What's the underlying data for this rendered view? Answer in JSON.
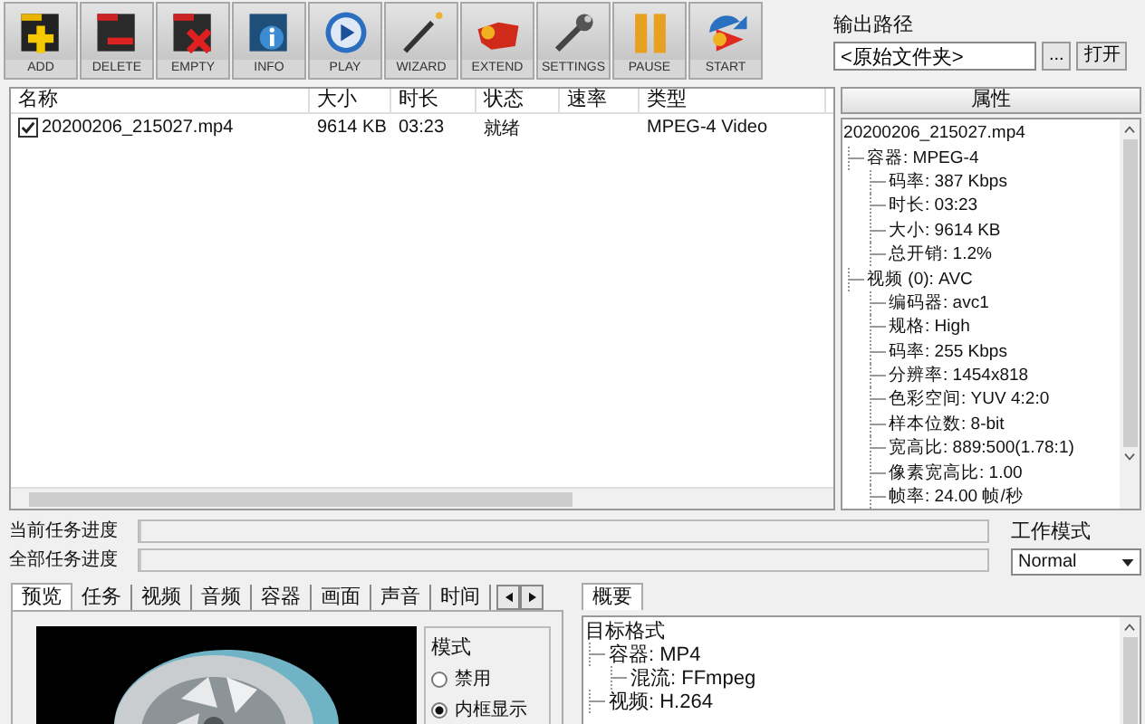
{
  "toolbar": [
    {
      "label": "ADD",
      "kind": "add"
    },
    {
      "label": "DELETE",
      "kind": "delete"
    },
    {
      "label": "EMPTY",
      "kind": "empty"
    },
    {
      "label": "INFO",
      "kind": "info"
    },
    {
      "label": "PLAY",
      "kind": "play"
    },
    {
      "label": "WIZARD",
      "kind": "wizard"
    },
    {
      "label": "EXTEND",
      "kind": "extend"
    },
    {
      "label": "SETTINGS",
      "kind": "settings"
    },
    {
      "label": "PAUSE",
      "kind": "pause"
    },
    {
      "label": "START",
      "kind": "start"
    }
  ],
  "output_path": {
    "label": "输出路径",
    "value": "<原始文件夹>",
    "browse_button": "...",
    "open_button": "打开"
  },
  "file_list": {
    "columns": [
      "名称",
      "大小",
      "时长",
      "状态",
      "速率",
      "类型"
    ],
    "rows": [
      {
        "checked": true,
        "name": "20200206_215027.mp4",
        "size": "9614 KB",
        "duration": "03:23",
        "status": "就绪",
        "type": "MPEG-4 Video"
      }
    ]
  },
  "properties": {
    "header": "属性",
    "tree": [
      {
        "text": "20200206_215027.mp4",
        "children": [
          {
            "text": "容器: MPEG-4",
            "children": [
              {
                "text": "码率: 387 Kbps"
              },
              {
                "text": "时长: 03:23"
              },
              {
                "text": "大小: 9614 KB"
              },
              {
                "text": "总开销: 1.2%"
              }
            ]
          },
          {
            "text": "视频 (0): AVC",
            "children": [
              {
                "text": "编码器: avc1"
              },
              {
                "text": "规格: High"
              },
              {
                "text": "码率: 255 Kbps"
              },
              {
                "text": "分辨率: 1454x818"
              },
              {
                "text": "色彩空间: YUV 4:2:0"
              },
              {
                "text": "样本位数: 8-bit"
              },
              {
                "text": "宽高比: 889:500(1.78:1)"
              },
              {
                "text": "像素宽高比: 1.00"
              },
              {
                "text": "帧率: 24.00 帧/秒"
              }
            ]
          }
        ]
      }
    ]
  },
  "progress": [
    {
      "label": "当前任务进度",
      "level": 0
    },
    {
      "label": "全部任务进度",
      "level": 0
    }
  ],
  "work_mode": {
    "label": "工作模式",
    "value": "Normal"
  },
  "preview_tabs": [
    {
      "label": "预览",
      "selected": true
    },
    {
      "label": "任务",
      "selected": false
    },
    {
      "label": "视频",
      "selected": false
    },
    {
      "label": "音频",
      "selected": false
    },
    {
      "label": "容器",
      "selected": false
    },
    {
      "label": "画面",
      "selected": false
    },
    {
      "label": "声音",
      "selected": false
    },
    {
      "label": "时间",
      "selected": false
    }
  ],
  "mode_group": {
    "title": "模式",
    "options": [
      {
        "label": "禁用",
        "selected": false
      },
      {
        "label": "内框显示",
        "selected": true
      }
    ]
  },
  "summary": {
    "tab": "概要",
    "tree": [
      {
        "text": "目标格式",
        "children": [
          {
            "text": "容器: MP4",
            "children": [
              {
                "text": "混流: FFmpeg"
              }
            ]
          },
          {
            "text": "视频: H.264"
          }
        ]
      }
    ]
  }
}
